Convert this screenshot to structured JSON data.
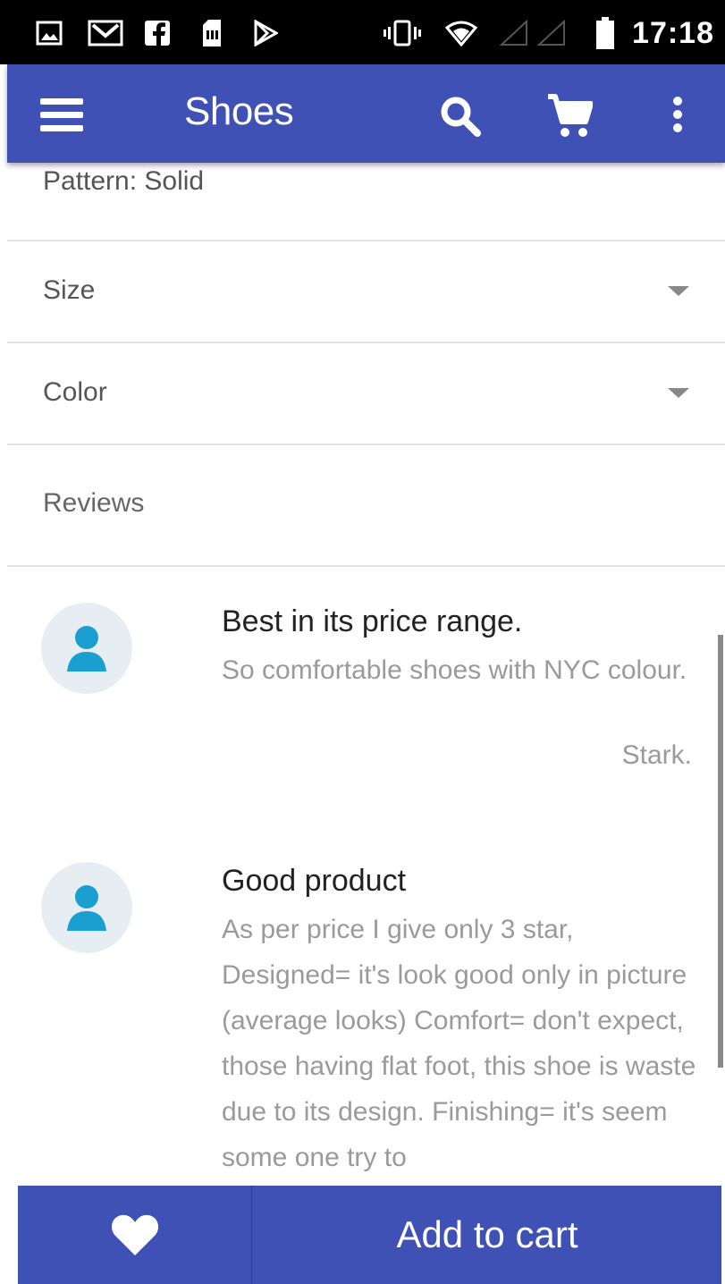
{
  "status_bar": {
    "time": "17:18",
    "icons": [
      "image-icon",
      "gmail-icon",
      "facebook-icon",
      "sim-card-icon",
      "play-store-icon",
      "vibrate-icon",
      "wifi-icon",
      "signal-icon",
      "signal-icon",
      "battery-icon"
    ]
  },
  "app_bar": {
    "title": "Shoes",
    "icons": [
      "menu-icon",
      "search-icon",
      "cart-icon",
      "more-vert-icon"
    ],
    "color": "#3f51b5"
  },
  "details": {
    "pattern_text": "Pattern: Solid",
    "size_label": "Size",
    "color_label": "Color",
    "reviews_label": "Reviews"
  },
  "reviews": [
    {
      "title": "Best in its price range.",
      "body": "So comfortable shoes with NYC colour.",
      "author": "Stark."
    },
    {
      "title": "Good product",
      "body": "As per price I give only 3 star, Designed= it's look good only in picture (average looks) Comfort= don't expect, those having flat foot, this shoe is waste due to its design. Finishing= it's seem some one try to",
      "author": ""
    }
  ],
  "bottom_bar": {
    "favorite_icon": "heart-icon",
    "add_to_cart_label": "Add to cart"
  }
}
